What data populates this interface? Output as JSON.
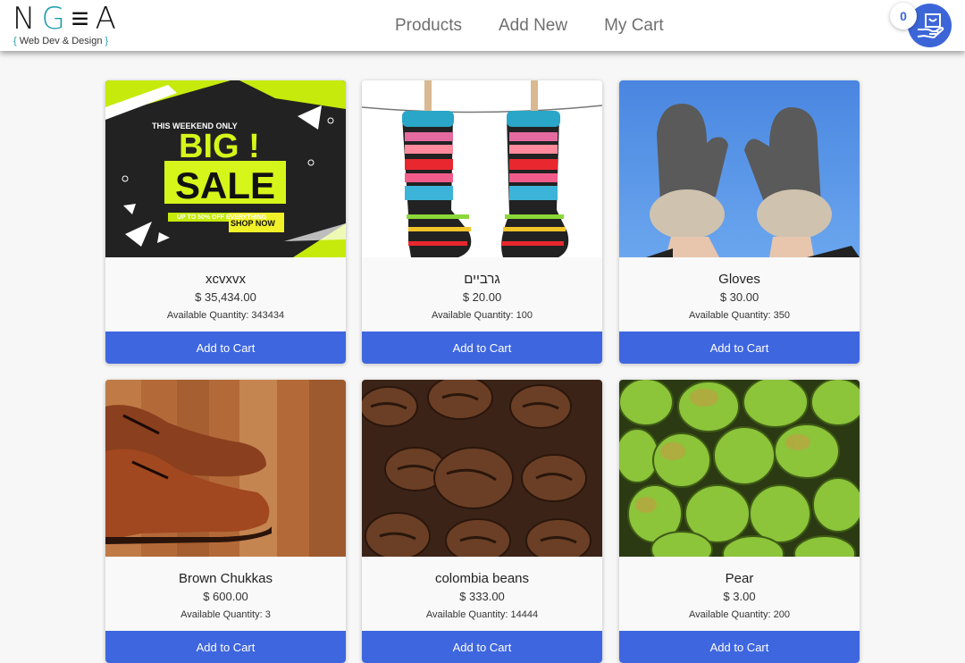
{
  "brand": {
    "logo_prefix": "N",
    "logo_accent": "G",
    "logo_suffix": "≡A",
    "brace_open": "{",
    "tagline": " Web Dev & Design ",
    "brace_close": "}"
  },
  "nav": {
    "products": "Products",
    "add_new": "Add New",
    "my_cart": "My Cart"
  },
  "cart": {
    "count": "0",
    "icon": "hand-cart-icon"
  },
  "colors": {
    "accent": "#3e66df",
    "brand_teal": "#1f9fa8",
    "background": "#f7f7f7"
  },
  "products": [
    {
      "name": "xcvxvx",
      "price": "$ 35,434.00",
      "quantity": "Available Quantity: 343434",
      "button": "Add to Cart",
      "image": "big-sale-banner"
    },
    {
      "name": "גרביים",
      "price": "$ 20.00",
      "quantity": "Available Quantity: 100",
      "button": "Add to Cart",
      "image": "striped-socks-on-line"
    },
    {
      "name": "Gloves",
      "price": "$ 30.00",
      "quantity": "Available Quantity: 350",
      "button": "Add to Cart",
      "image": "wool-mittens-sky"
    },
    {
      "name": "Brown Chukkas",
      "price": "$ 600.00",
      "quantity": "Available Quantity: 3",
      "button": "Add to Cart",
      "image": "brown-shoes-wood-floor"
    },
    {
      "name": "colombia beans",
      "price": "$ 333.00",
      "quantity": "Available Quantity: 14444",
      "button": "Add to Cart",
      "image": "coffee-beans"
    },
    {
      "name": "Pear",
      "price": "$ 3.00",
      "quantity": "Available Quantity: 200",
      "button": "Add to Cart",
      "image": "green-pears"
    }
  ],
  "banner": {
    "line1": "THIS WEEKEND ONLY",
    "big": "BIG !",
    "sale": "SALE",
    "offer": "UP TO 50% OFF EVERYTHING",
    "cta": "SHOP NOW"
  }
}
